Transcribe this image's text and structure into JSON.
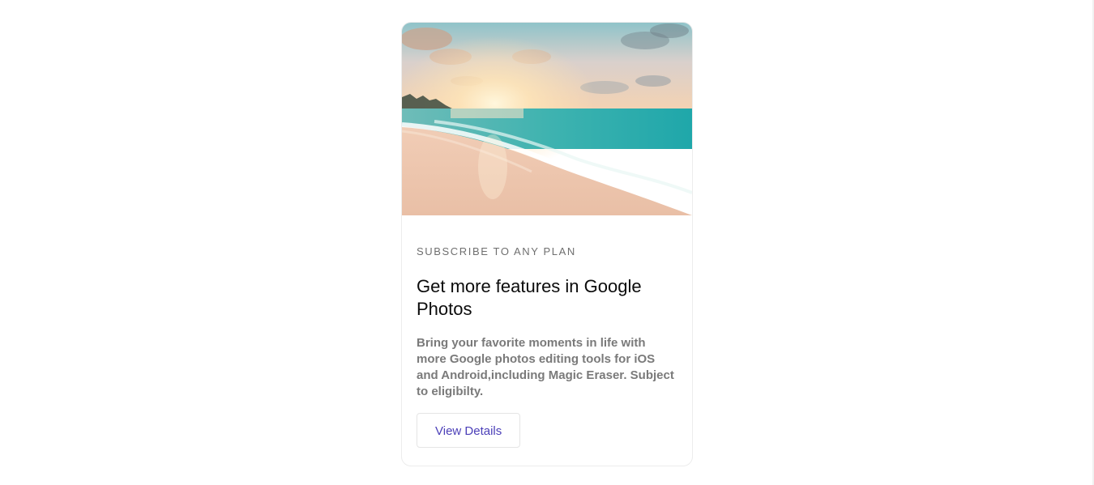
{
  "card": {
    "image_alt": "beach-sunset-image",
    "eyebrow": "SUBSCRIBE TO ANY PLAN",
    "title": "Get more features in Google Photos",
    "description": "Bring your favorite moments in life with more Google photos editing tools for iOS and Android,including Magic Eraser. Subject to eligibilty.",
    "button_label": "View Details"
  },
  "colors": {
    "button_text": "#4b3fb8",
    "eyebrow_text": "#6f6f6f",
    "description_text": "#7a7a7a",
    "title_text": "#0b0b0b"
  }
}
